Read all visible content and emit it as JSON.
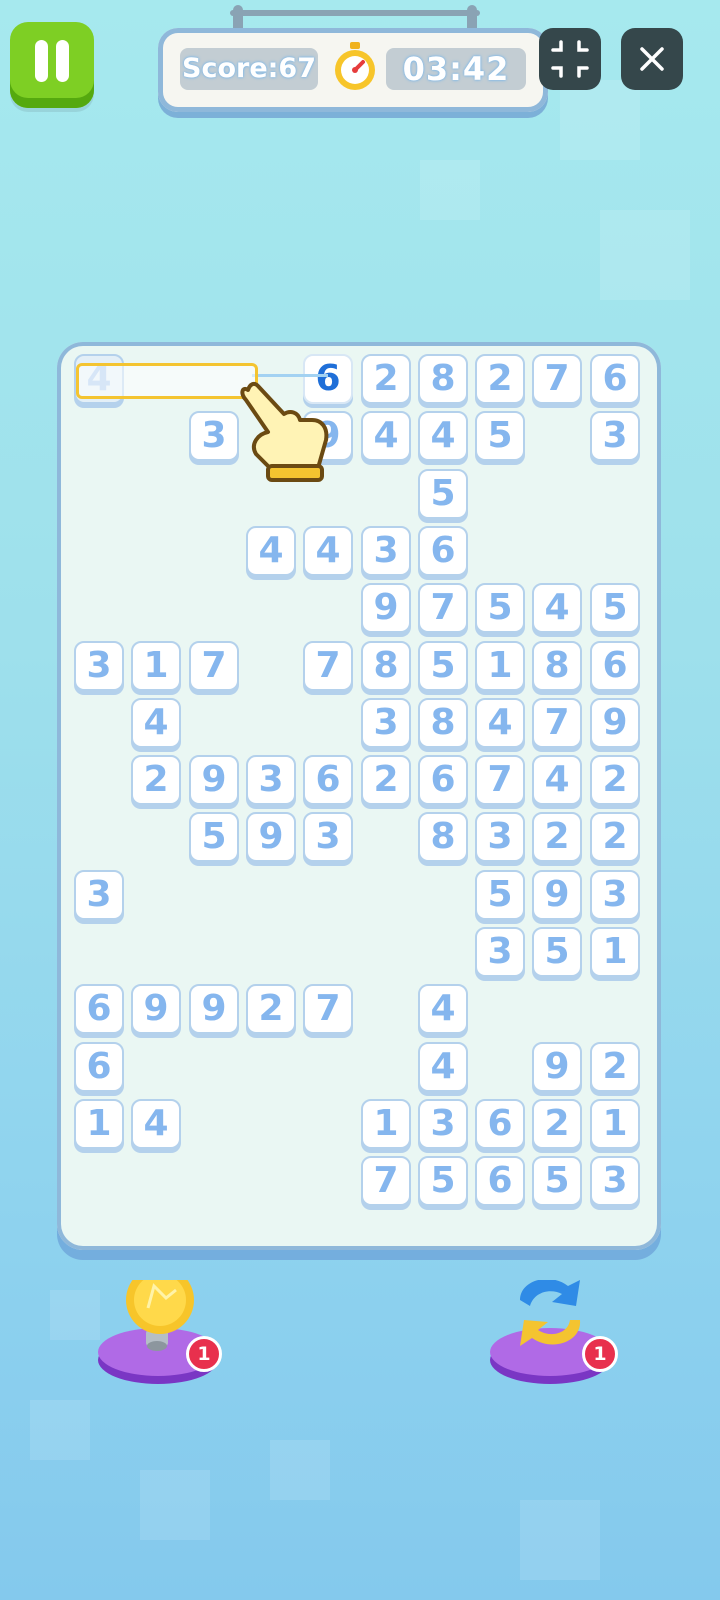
{
  "hud": {
    "score_label": "Score:67",
    "timer": "03:42"
  },
  "grid": {
    "rows": [
      [
        "4",
        "",
        "",
        "",
        "6",
        "2",
        "8",
        "2",
        "7",
        "6"
      ],
      [
        "",
        "",
        "3",
        "",
        "9",
        "4",
        "4",
        "5",
        "",
        "3"
      ],
      [
        "",
        "",
        "",
        "",
        "",
        "",
        "5",
        "",
        "",
        ""
      ],
      [
        "",
        "",
        "",
        "4",
        "4",
        "3",
        "6",
        "",
        "",
        ""
      ],
      [
        "",
        "",
        "",
        "",
        "",
        "9",
        "7",
        "5",
        "4",
        "5"
      ],
      [
        "3",
        "1",
        "7",
        "",
        "7",
        "8",
        "5",
        "1",
        "8",
        "6"
      ],
      [
        "",
        "4",
        "",
        "",
        "",
        "3",
        "8",
        "4",
        "7",
        "9"
      ],
      [
        "",
        "2",
        "9",
        "3",
        "6",
        "2",
        "6",
        "7",
        "4",
        "2"
      ],
      [
        "",
        "",
        "5",
        "9",
        "3",
        "",
        "8",
        "3",
        "2",
        "2"
      ],
      [
        "3",
        "",
        "",
        "",
        "",
        "",
        "",
        "5",
        "9",
        "3"
      ],
      [
        "",
        "",
        "",
        "",
        "",
        "",
        "",
        "3",
        "5",
        "1"
      ],
      [
        "6",
        "9",
        "9",
        "2",
        "7",
        "",
        "4",
        "",
        "",
        ""
      ],
      [
        "6",
        "",
        "",
        "",
        "",
        "",
        "4",
        "",
        "9",
        "2"
      ],
      [
        "1",
        "4",
        "",
        "",
        "",
        "1",
        "3",
        "6",
        "2",
        "1"
      ],
      [
        "",
        "",
        "",
        "",
        "",
        "7",
        "5",
        "6",
        "5",
        "3"
      ]
    ]
  },
  "powerups": {
    "hint_count": "1",
    "shuffle_count": "1"
  },
  "colors": {
    "accent_green": "#7ecf24",
    "number_blue": "#85b6ee",
    "selected_number": "#1f6fd8",
    "highlight": "#f4c430",
    "badge_red": "#e8304d"
  },
  "icons": [
    "pause-icon",
    "stopwatch-icon",
    "exit-fullscreen-icon",
    "close-icon",
    "pointing-hand-icon",
    "lightbulb-hint-icon",
    "shuffle-arrows-icon"
  ]
}
